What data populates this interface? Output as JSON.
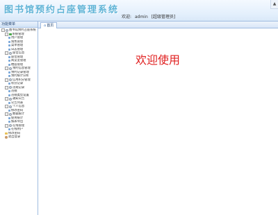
{
  "header": {
    "title": "图书馆预约占座管理系统",
    "welcome_prefix": "欢迎:",
    "username": "admin",
    "role": "[超级管理员]",
    "scroll_glyph": "▲"
  },
  "sidebar": {
    "heading": "功能菜单",
    "items": [
      {
        "label": "图书馆预约占座系统",
        "level": 0,
        "icon": "gear-icon",
        "toggle": "−"
      },
      {
        "label": "系统管理",
        "level": 1,
        "icon": "green-icon",
        "toggle": "−"
      },
      {
        "label": "用户管理",
        "level": 2,
        "icon": "leaf-icon"
      },
      {
        "label": "角色管理",
        "level": 2,
        "icon": "leaf-icon"
      },
      {
        "label": "菜单管理",
        "level": 2,
        "icon": "leaf-icon"
      },
      {
        "label": "日志管理",
        "level": 2,
        "icon": "leaf-icon"
      },
      {
        "label": "座位信息",
        "level": 1,
        "icon": "gear-icon",
        "toggle": "−"
      },
      {
        "label": "座位管理",
        "level": 2,
        "icon": "leaf-icon"
      },
      {
        "label": "阅览室管理",
        "level": 2,
        "icon": "leaf-icon"
      },
      {
        "label": "楼层管理",
        "level": 2,
        "icon": "leaf-icon"
      },
      {
        "label": "预约信息管理",
        "level": 1,
        "icon": "gear-icon",
        "toggle": "−"
      },
      {
        "label": "预约记录管理",
        "level": 2,
        "icon": "leaf-icon"
      },
      {
        "label": "预约统计分析",
        "level": 2,
        "icon": "leaf-icon"
      },
      {
        "label": "信用积分管理",
        "level": 1,
        "icon": "gear-icon",
        "toggle": "−"
      },
      {
        "label": "积分记录",
        "level": 2,
        "icon": "leaf-icon"
      },
      {
        "label": "违规记录",
        "level": 1,
        "icon": "gear-icon",
        "toggle": "−"
      },
      {
        "label": "违规",
        "level": 2,
        "icon": "leaf-icon"
      },
      {
        "label": "违规类型设置",
        "level": 2,
        "icon": "leaf-icon"
      },
      {
        "label": "通知公告",
        "level": 1,
        "icon": "gear-icon",
        "toggle": "−"
      },
      {
        "label": "公告列表",
        "level": 2,
        "icon": "leaf-icon"
      },
      {
        "label": "个人信息",
        "level": 1,
        "icon": "gear-icon",
        "toggle": "−"
      },
      {
        "label": "修改密码",
        "level": 2,
        "icon": "leaf-icon"
      },
      {
        "label": "数据统计",
        "level": 1,
        "icon": "gear-icon",
        "toggle": "−"
      },
      {
        "label": "使用统计",
        "level": 2,
        "icon": "leaf-icon"
      },
      {
        "label": "报表导出",
        "level": 2,
        "icon": "leaf-icon"
      },
      {
        "label": "在线管理",
        "level": 1,
        "icon": "gear-icon",
        "toggle": "−"
      },
      {
        "label": "在线用户",
        "level": 2,
        "icon": "leaf-icon"
      },
      {
        "label": "修改密码",
        "level": 1,
        "icon": "folder-icon"
      },
      {
        "label": "退出登录",
        "level": 1,
        "icon": "man-icon"
      }
    ]
  },
  "main": {
    "tab_label": "首页",
    "tab_icon": "⌂",
    "welcome": "欢迎使用"
  }
}
